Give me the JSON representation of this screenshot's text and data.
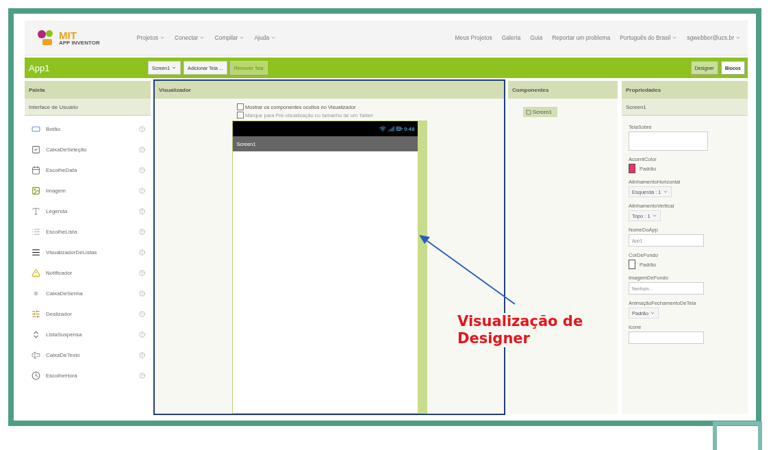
{
  "logo": {
    "title": "MIT",
    "subtitle": "APP INVENTOR"
  },
  "nav_menus": [
    {
      "label": "Projetos",
      "kind": "dropdown"
    },
    {
      "label": "Conectar",
      "kind": "dropdown"
    },
    {
      "label": "Compilar",
      "kind": "dropdown"
    },
    {
      "label": "Ajuda",
      "kind": "dropdown"
    }
  ],
  "nav_links": [
    {
      "label": "Meus Projetos",
      "kind": "link"
    },
    {
      "label": "Galeria",
      "kind": "link"
    },
    {
      "label": "Guia",
      "kind": "link"
    },
    {
      "label": "Reportar um problema",
      "kind": "link"
    },
    {
      "label": "Português do Brasil",
      "kind": "dropdown"
    },
    {
      "label": "sgwebber@ucs.br",
      "kind": "dropdown"
    }
  ],
  "project_title": "App1",
  "screen_buttons": [
    {
      "label": "Screen1",
      "kind": "dropdown",
      "disabled": false
    },
    {
      "label": "Adicionar Tela ...",
      "kind": "button",
      "disabled": false
    },
    {
      "label": "Remover Tela",
      "kind": "button",
      "disabled": true
    }
  ],
  "mode_buttons": [
    {
      "label": "Designer",
      "selected": true
    },
    {
      "label": "Blocos",
      "selected": false
    }
  ],
  "palette": {
    "title": "Paleta",
    "section": "Interface de Usuário",
    "items": [
      {
        "label": "Botão",
        "kind": "button"
      },
      {
        "label": "CaixaDeSeleção",
        "kind": "checkbox"
      },
      {
        "label": "EscolheData",
        "kind": "datepicker"
      },
      {
        "label": "Imagem",
        "kind": "image"
      },
      {
        "label": "Legenda",
        "kind": "label"
      },
      {
        "label": "EscolheLista",
        "kind": "listpicker"
      },
      {
        "label": "VisualizadorDeListas",
        "kind": "listview"
      },
      {
        "label": "Notificador",
        "kind": "notifier"
      },
      {
        "label": "CaixaDeSenha",
        "kind": "password"
      },
      {
        "label": "Deslizador",
        "kind": "slider"
      },
      {
        "label": "ListaSuspensa",
        "kind": "spinner"
      },
      {
        "label": "CaixaDeTexto",
        "kind": "textbox"
      },
      {
        "label": "EscolheHora",
        "kind": "timepicker"
      }
    ]
  },
  "viewer": {
    "title": "Visualizador",
    "highlighted": true,
    "options": [
      {
        "label": "Mostrar os componentes ocultos no Visualizador",
        "checked": false
      },
      {
        "label": "Marque para Pré-visualização no tamanho de um Tablet",
        "checked": false
      }
    ],
    "phone": {
      "time": "9:48",
      "screen_title": "Screen1"
    }
  },
  "annotation": {
    "label": "Visualização de Designer"
  },
  "components": {
    "title": "Componentes",
    "items": [
      {
        "label": "Screen1",
        "selected": true
      }
    ]
  },
  "properties": {
    "title": "Propriedades",
    "component": "Screen1",
    "items": [
      {
        "label": "TelaSobre",
        "kind": "textarea"
      },
      {
        "label": "AccentColor",
        "kind": "color",
        "value": "Padrão",
        "color": "#e8336b"
      },
      {
        "label": "AlinhamentoHorizontal",
        "kind": "dropdown",
        "value": "Esquerda : 1"
      },
      {
        "label": "AlinhamentoVertical",
        "kind": "dropdown",
        "value": "Topo : 1"
      },
      {
        "label": "NomeDoApp",
        "kind": "text",
        "value": "App1"
      },
      {
        "label": "CorDeFundo",
        "kind": "color",
        "value": "Padrão",
        "color": "#ffffff"
      },
      {
        "label": "ImagemDeFundo",
        "kind": "text",
        "value": "Nenhum..."
      },
      {
        "label": "AnimaçãoFechamentoDeTela",
        "kind": "dropdown",
        "value": "Padrão"
      },
      {
        "label": "Icone",
        "kind": "text"
      }
    ]
  }
}
